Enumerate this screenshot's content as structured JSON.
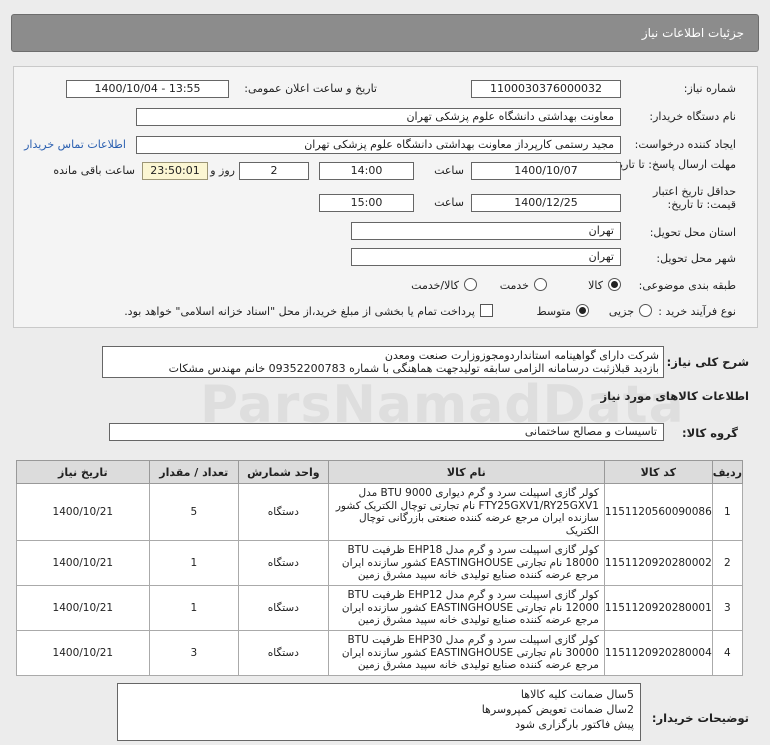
{
  "header": {
    "title": "جزئیات اطلاعات نیاز"
  },
  "fields": {
    "need_number_label": "شماره نیاز:",
    "need_number": "1100030376000032",
    "announce_label": "تاریخ و ساعت اعلان عمومی:",
    "announce_value": "1400/10/04 - 13:55",
    "buyer_org_label": "نام دستگاه خریدار:",
    "buyer_org": "معاونت بهداشتی دانشگاه علوم پزشکی تهران",
    "requester_label": "ایجاد کننده درخواست:",
    "requester": "مجید رستمی کارپرداز معاونت بهداشتی دانشگاه علوم پزشکی تهران",
    "buyer_contact_link": "اطلاعات تماس خریدار",
    "deadline_label": "مهلت ارسال پاسخ: تا تاریخ:",
    "deadline_date": "1400/10/07",
    "time_label": "ساعت",
    "deadline_time": "14:00",
    "days_label": "روز و",
    "days_value": "2",
    "remaining_time": "23:50:01",
    "remaining_label": "ساعت باقی مانده",
    "validity_label_1": "حداقل تاریخ اعتبار",
    "validity_label_2": "قیمت: تا تاریخ:",
    "validity_date": "1400/12/25",
    "validity_time": "15:00",
    "province_label": "استان محل تحویل:",
    "province": "تهران",
    "city_label": "شهر محل تحویل:",
    "city": "تهران",
    "category_label": "طبقه بندی موضوعی:",
    "category_options": [
      "کالا",
      "خدمت",
      "کالا/خدمت"
    ],
    "process_label": "نوع فرآیند خرید :",
    "process_options": [
      "جزیی",
      "متوسط"
    ],
    "payment_note": "پرداخت تمام یا بخشی از مبلغ خرید،از محل \"اسناد خزانه اسلامی\" خواهد بود."
  },
  "description": {
    "label": "شرح کلی نیاز:",
    "line1": "شرکت دارای گواهینامه استانداردومجوزوزارت صنعت ومعدن",
    "line2": "بازدید قبلازثبت درسامانه الزامی سابقه تولیدجهت هماهنگی با شماره 09352200783 خانم مهندس مشکات"
  },
  "goods": {
    "section_title": "اطلاعات کالاهای مورد نیاز",
    "group_label": "گروه کالا:",
    "group_value": "تاسیسات و مصالح ساختمانی",
    "columns": [
      "ردیف",
      "کد کالا",
      "نام کالا",
      "واحد شمارش",
      "تعداد / مقدار",
      "تاریخ نیاز"
    ],
    "rows": [
      {
        "row": "1",
        "code": "1151120560090086",
        "name": "کولر گازی اسپیلت سرد و گرم دیواری BTU 9000 مدل FTY25GXV1/RY25GXV1 نام تجارتی توچال الکتریک کشور سازنده ایران مرجع عرضه کننده صنعتی بازرگانی توچال الکتریک",
        "unit": "دستگاه",
        "qty": "5",
        "date": "1400/10/21"
      },
      {
        "row": "2",
        "code": "1151120920280002",
        "name": "کولر گازی اسپیلت سرد و گرم مدل EHP18 ظرفیت BTU 18000 نام تجارتی EASTINGHOUSE کشور سازنده ایران مرجع عرضه کننده صنایع تولیدی خانه سپید مشرق زمین",
        "unit": "دستگاه",
        "qty": "1",
        "date": "1400/10/21"
      },
      {
        "row": "3",
        "code": "1151120920280001",
        "name": "کولر گازی اسپیلت سرد و گرم مدل EHP12 ظرفیت BTU 12000 نام تجارتی EASTINGHOUSE کشور سازنده ایران مرجع عرضه کننده صنایع تولیدی خانه سپید مشرق زمین",
        "unit": "دستگاه",
        "qty": "1",
        "date": "1400/10/21"
      },
      {
        "row": "4",
        "code": "1151120920280004",
        "name": "کولر گازی اسپیلت سرد و گرم مدل EHP30 ظرفیت BTU 30000 نام تجارتی EASTINGHOUSE کشور سازنده ایران مرجع عرضه کننده صنایع تولیدی خانه سپید مشرق زمین",
        "unit": "دستگاه",
        "qty": "3",
        "date": "1400/10/21"
      }
    ]
  },
  "buyer_notes": {
    "label": "توضیحات خریدار:",
    "lines": [
      "5سال ضمانت کلیه کالاها",
      "2سال ضمانت تعویض کمپروسرها",
      "پیش فاکتور بارگزاری شود"
    ]
  },
  "watermark": "ParsNamadData"
}
